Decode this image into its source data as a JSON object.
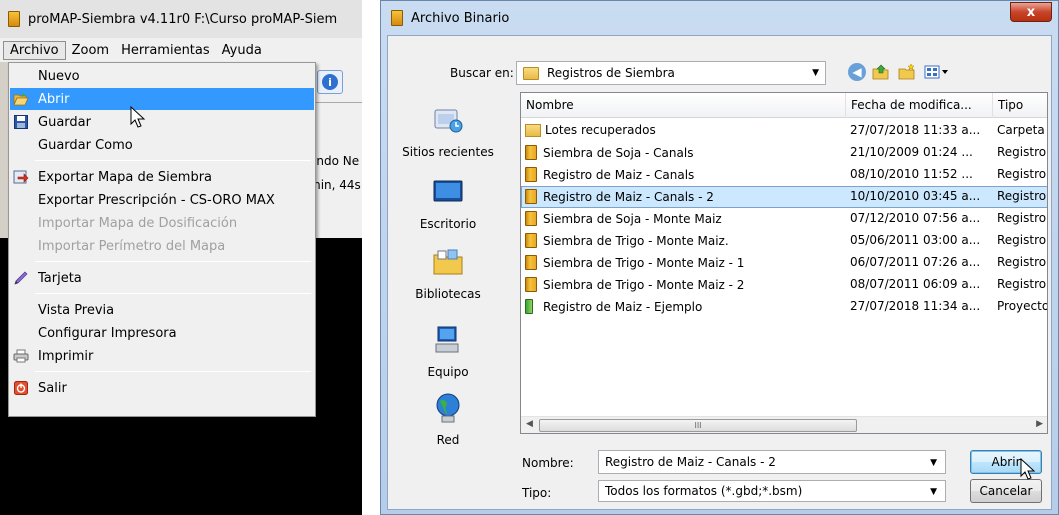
{
  "left_window": {
    "title": "proMAP-Siembra v4.11r0   F:\\Curso proMAP-Siem",
    "menubar": [
      "Archivo",
      "Zoom",
      "Herramientas",
      "Ayuda"
    ],
    "behind_text_1": "ondo Ne",
    "behind_text_2": "min, 44s",
    "file_menu": {
      "items": [
        {
          "label": "Nuevo",
          "icon": "",
          "state": "normal"
        },
        {
          "label": "Abrir",
          "icon": "open-folder-icon",
          "state": "highlighted"
        },
        {
          "label": "Guardar",
          "icon": "floppy-disk-icon",
          "state": "normal"
        },
        {
          "label": "Guardar Como",
          "icon": "",
          "state": "normal"
        },
        {
          "label": "Exportar Mapa de Siembra",
          "icon": "export-icon",
          "state": "normal"
        },
        {
          "label": "Exportar Prescripción - CS-ORO MAX",
          "icon": "",
          "state": "normal"
        },
        {
          "label": "Importar Mapa de Dosificación",
          "icon": "",
          "state": "disabled"
        },
        {
          "label": "Importar Perímetro del Mapa",
          "icon": "",
          "state": "disabled"
        },
        {
          "label": "Tarjeta",
          "icon": "card-pen-icon",
          "state": "normal"
        },
        {
          "label": "Vista Previa",
          "icon": "",
          "state": "normal"
        },
        {
          "label": "Configurar Impresora",
          "icon": "",
          "state": "normal"
        },
        {
          "label": "Imprimir",
          "icon": "printer-icon",
          "state": "normal"
        },
        {
          "label": "Salir",
          "icon": "exit-icon",
          "state": "normal"
        }
      ]
    }
  },
  "dialog": {
    "title": "Archivo Binario",
    "close_glyph": "x",
    "look_in_label": "Buscar en:",
    "look_in_value": "Registros de Siembra",
    "places": [
      "Sitios recientes",
      "Escritorio",
      "Bibliotecas",
      "Equipo",
      "Red"
    ],
    "columns": [
      "Nombre",
      "Fecha de modifica...",
      "Tipo"
    ],
    "files": [
      {
        "name": "Lotes recuperados",
        "date": "27/07/2018 11:33 a...",
        "type": "Carpeta d",
        "kind": "folder",
        "selected": false
      },
      {
        "name": "Siembra de Soja - Canals",
        "date": "21/10/2009 01:24 ...",
        "type": "Registro d",
        "kind": "file",
        "selected": false
      },
      {
        "name": "Registro de Maiz - Canals",
        "date": "08/10/2010 11:52 ...",
        "type": "Registro d",
        "kind": "file",
        "selected": false
      },
      {
        "name": "Registro de Maiz - Canals - 2",
        "date": "10/10/2010 03:45 a...",
        "type": "Registro d",
        "kind": "file",
        "selected": true
      },
      {
        "name": "Siembra de Soja - Monte Maiz",
        "date": "07/12/2010 07:56 a...",
        "type": "Registro d",
        "kind": "file",
        "selected": false
      },
      {
        "name": "Siembra de Trigo - Monte Maiz.",
        "date": "05/06/2011 03:00 a...",
        "type": "Registro d",
        "kind": "file",
        "selected": false
      },
      {
        "name": "Siembra de Trigo - Monte Maiz - 1",
        "date": "06/07/2011 07:26 a...",
        "type": "Registro d",
        "kind": "file",
        "selected": false
      },
      {
        "name": "Siembra de Trigo - Monte Maiz - 2",
        "date": "08/07/2011 06:09 a...",
        "type": "Registro d",
        "kind": "file",
        "selected": false
      },
      {
        "name": "Registro de Maiz - Ejemplo",
        "date": "27/07/2018 11:34 a...",
        "type": "Proyecto",
        "kind": "project",
        "selected": false
      }
    ],
    "scroll_thumb_glyph": "III",
    "filename_label": "Nombre:",
    "filename_value": "Registro de Maiz - Canals - 2",
    "filetype_label": "Tipo:",
    "filetype_value": "Todos los formatos (*.gbd;*.bsm)",
    "open_button": "Abrir",
    "cancel_button": "Cancelar"
  }
}
